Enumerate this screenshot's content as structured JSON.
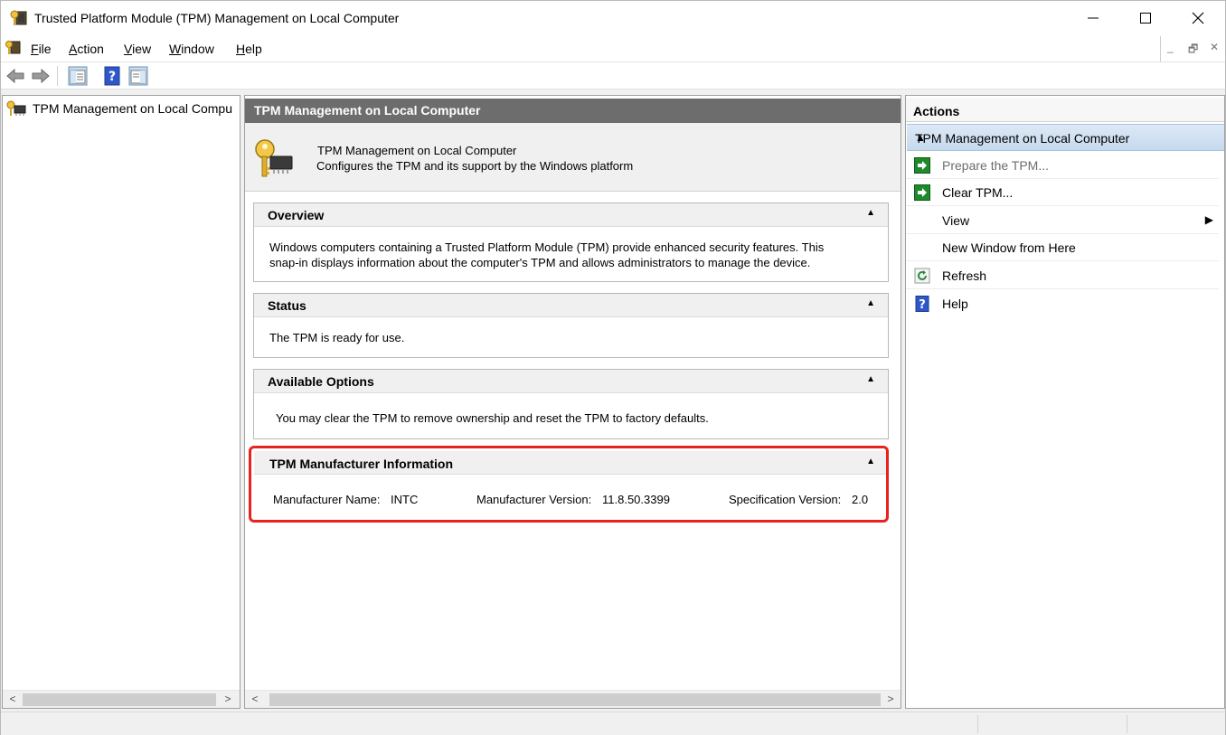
{
  "window": {
    "title": "Trusted Platform Module (TPM) Management on Local Computer",
    "minimize_icon": "minimize-icon",
    "maximize_icon": "maximize-icon",
    "close_icon": "close-icon"
  },
  "menubar": {
    "items": [
      {
        "underline": "F",
        "rest": "ile"
      },
      {
        "underline": "A",
        "rest": "ction"
      },
      {
        "underline": "V",
        "rest": "iew"
      },
      {
        "underline": "W",
        "rest": "indow"
      },
      {
        "underline": "H",
        "rest": "elp"
      }
    ],
    "mdi_controls": [
      "_",
      "🗗",
      "✕"
    ]
  },
  "toolbar": {
    "icons": [
      "back-arrow-icon",
      "forward-arrow-icon",
      "show-hide-console-tree-icon",
      "help-icon",
      "show-hide-action-pane-icon"
    ]
  },
  "tree": {
    "root_label": "TPM Management on Local Compu",
    "scroll_left": "<",
    "scroll_right": ">"
  },
  "center": {
    "header": "TPM Management on Local Computer",
    "intro_title": "TPM Management on Local Computer",
    "intro_description": "Configures the TPM and its support by the Windows platform",
    "sections": {
      "overview": {
        "title": "Overview",
        "collapse": "▲",
        "line1": "Windows computers containing a Trusted Platform Module (TPM) provide enhanced security features. This",
        "line2": "snap-in displays information about the computer's TPM and allows administrators to manage the device."
      },
      "status": {
        "title": "Status",
        "collapse": "▲",
        "text": "The TPM is ready for use."
      },
      "options": {
        "title": "Available Options",
        "collapse": "▲",
        "text": "You may clear the TPM to remove ownership and reset the TPM to factory defaults."
      },
      "manufacturer": {
        "title": "TPM Manufacturer Information",
        "collapse": "▲",
        "name_label": "Manufacturer Name:",
        "name_value": "INTC",
        "version_label": "Manufacturer Version:",
        "version_value": "11.8.50.3399",
        "spec_label": "Specification Version:",
        "spec_value": "2.0"
      }
    },
    "scroll_left": "<",
    "scroll_right": ">"
  },
  "actions": {
    "title": "Actions",
    "group": "TPM Management on Local Computer",
    "group_collapse": "▲",
    "items": [
      {
        "label": "Prepare the TPM...",
        "icon": "run-action-icon",
        "disabled": true
      },
      {
        "label": "Clear TPM...",
        "icon": "run-action-icon",
        "disabled": false
      },
      {
        "label": "View",
        "icon": "",
        "submenu": "▶"
      },
      {
        "label": "New Window from Here",
        "icon": ""
      },
      {
        "label": "Refresh",
        "icon": "refresh-icon"
      },
      {
        "label": "Help",
        "icon": "help-icon"
      }
    ]
  },
  "colors": {
    "highlight_border": "#e8231f",
    "center_header_bg": "#6d6d6d",
    "action_group_bg": "#cfe0f1",
    "action_icon_green": "#1e8a2c",
    "help_icon_blue": "#2e58c9"
  }
}
